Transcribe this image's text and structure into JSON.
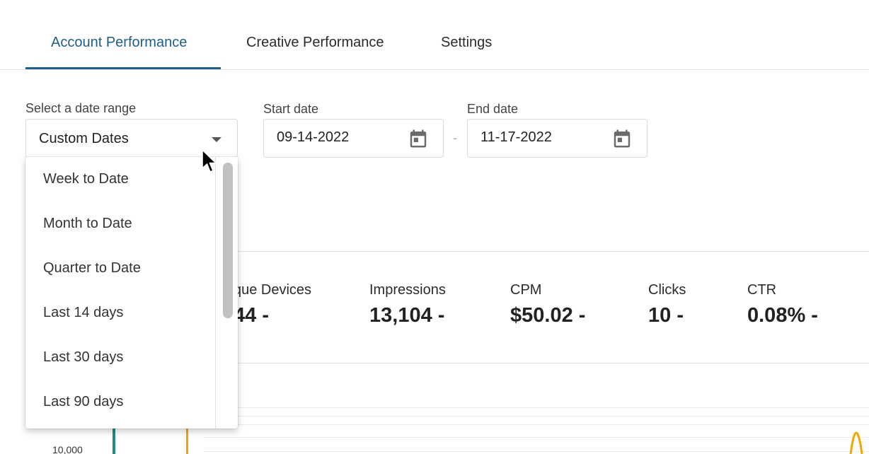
{
  "tabs": [
    {
      "label": "Account Performance",
      "active": true
    },
    {
      "label": "Creative Performance",
      "active": false
    },
    {
      "label": "Settings",
      "active": false
    }
  ],
  "filters": {
    "date_range_label": "Select a date range",
    "date_range_value": "Custom Dates",
    "start_label": "Start date",
    "start_value": "09-14-2022",
    "end_label": "End date",
    "end_value": "11-17-2022",
    "separator": "-"
  },
  "dropdown": {
    "options": [
      "Week to Date",
      "Month to Date",
      "Quarter to Date",
      "Last 14 days",
      "Last 30 days",
      "Last 90 days"
    ]
  },
  "metrics": [
    {
      "label": "que Devices",
      "value": "44 -"
    },
    {
      "label": "Impressions",
      "value": "13,104 -"
    },
    {
      "label": "CPM",
      "value": "$50.02 -"
    },
    {
      "label": "Clicks",
      "value": "10 -"
    },
    {
      "label": "CTR",
      "value": "0.08% -"
    }
  ],
  "chart": {
    "y_tick": "10,000"
  },
  "colors": {
    "accent": "#1f5e88",
    "teal": "#1f8c86",
    "orange": "#f0a800"
  },
  "icons": {
    "caret": "caret-down-icon",
    "calendar": "calendar-icon",
    "cursor": "mouse-pointer-icon"
  }
}
